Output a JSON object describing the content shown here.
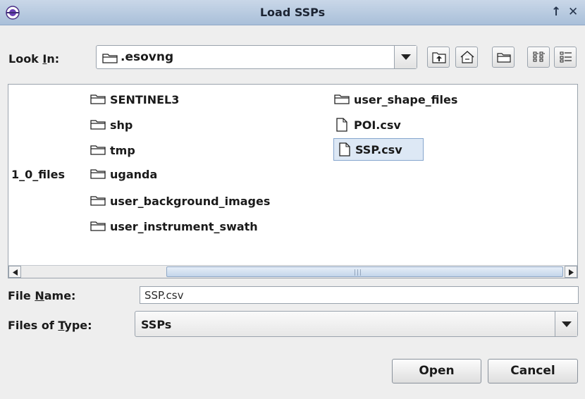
{
  "window": {
    "title": "Load SSPs",
    "restore_glyph": "↑",
    "close_glyph": "✕"
  },
  "look_in": {
    "label_pre": "Look ",
    "label_mnemonic": "I",
    "label_post": "n:",
    "value": ".esovng"
  },
  "toolbar_icons": [
    "up-one-level-icon",
    "home-icon",
    "new-folder-icon",
    "list-view-icon",
    "details-view-icon"
  ],
  "files": {
    "column1": [
      "SENTINEL3",
      "shp",
      "tmp",
      "uganda",
      "user_background_images",
      "user_instrument_swath"
    ],
    "column2": [
      {
        "name": "user_shape_files",
        "kind": "folder"
      },
      {
        "name": "POI.csv",
        "kind": "file"
      },
      {
        "name": "SSP.csv",
        "kind": "file",
        "selected": true
      }
    ],
    "truncated_label": "1_0_files"
  },
  "file_name": {
    "label_pre": "File ",
    "label_mnemonic": "N",
    "label_post": "ame:",
    "value": "SSP.csv"
  },
  "files_of_type": {
    "label_pre": "Files of ",
    "label_mnemonic": "T",
    "label_post": "ype:",
    "value": "SSPs"
  },
  "buttons": {
    "open": "Open",
    "cancel": "Cancel"
  },
  "colors": {
    "title_bar": "#b9cbe2",
    "selection": "#dde8f5",
    "selection_border": "#86a6cd"
  }
}
